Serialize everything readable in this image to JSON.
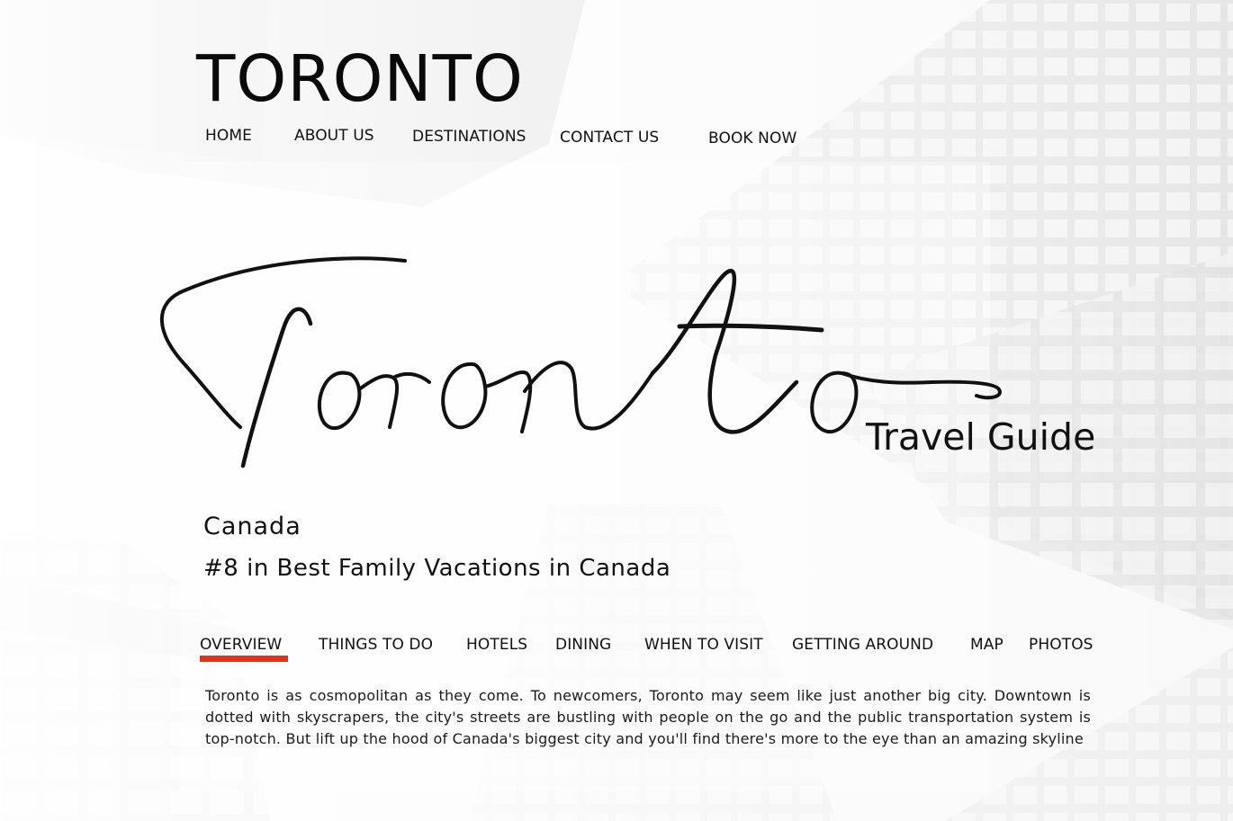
{
  "header": {
    "brand": "TORONTO",
    "nav": [
      {
        "label": "HOME"
      },
      {
        "label": "ABOUT US"
      },
      {
        "label": "DESTINATIONS"
      },
      {
        "label": "CONTACT US"
      },
      {
        "label": "BOOK NOW"
      }
    ]
  },
  "hero": {
    "script_word": "Toronto",
    "subtitle": "Travel Guide"
  },
  "intro": {
    "country": "Canada",
    "ranking": "#8 in Best Family Vacations in Canada"
  },
  "tabs": {
    "active_index": 0,
    "accent_color": "#ec2f12",
    "items": [
      {
        "label": "OVERVIEW"
      },
      {
        "label": "THINGS TO DO"
      },
      {
        "label": "HOTELS"
      },
      {
        "label": "DINING"
      },
      {
        "label": "WHEN TO VISIT"
      },
      {
        "label": "GETTING AROUND"
      },
      {
        "label": "MAP"
      },
      {
        "label": "PHOTOS"
      }
    ]
  },
  "overview": {
    "text": "Toronto is as cosmopolitan as they come. To newcomers, Toronto may seem like just another big city. Downtown is dotted with skyscrapers, the city's streets are bustling with people on the go and the public transportation system is top-notch. But lift up the hood of Canada's biggest city and you'll find there's more to the eye than an amazing skyline"
  },
  "background": {
    "description_icon": "skyscraper-background-image"
  }
}
